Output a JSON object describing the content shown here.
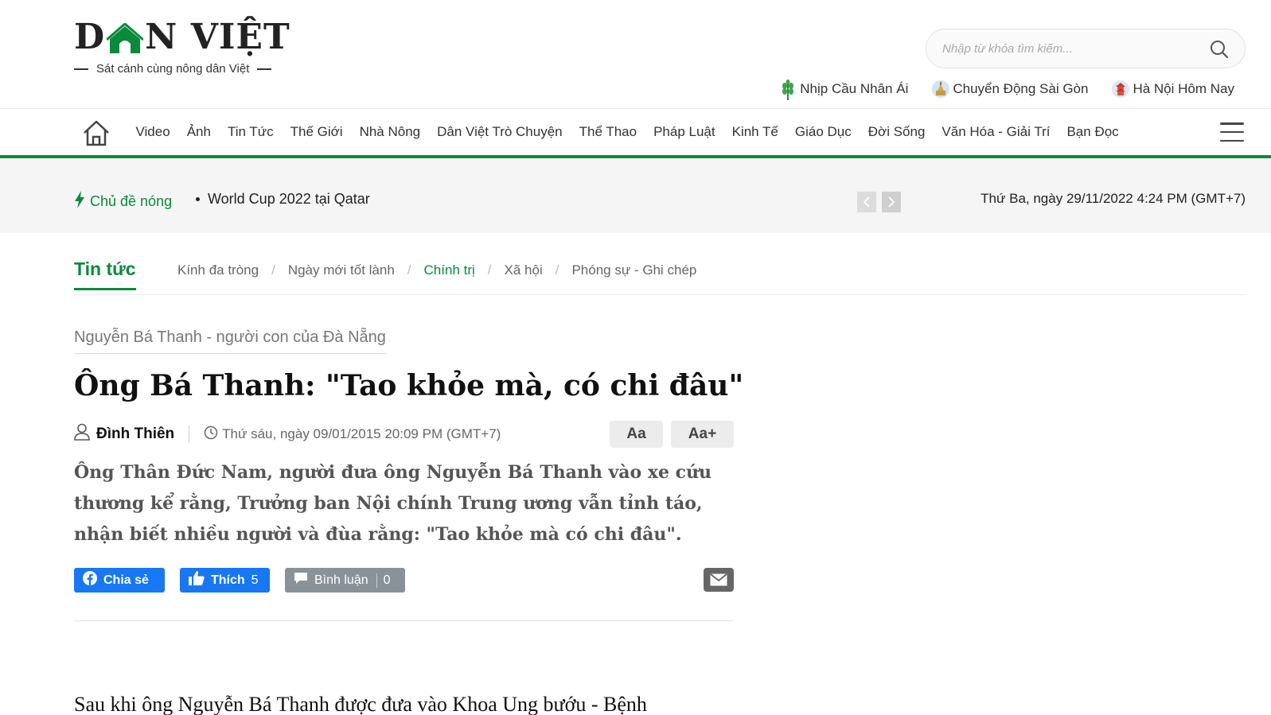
{
  "header": {
    "logo_text_before": "D",
    "logo_text_after": "N VIỆT",
    "logo_tagline": "Sát cánh cùng nông dân Việt",
    "search_placeholder": "Nhập từ khóa tìm kiếm...",
    "quick_links": [
      {
        "label": "Nhịp Cầu Nhân Ái",
        "icon": "wheat-icon"
      },
      {
        "label": "Chuyển Động Sài Gòn",
        "icon": "landmark-icon"
      },
      {
        "label": "Hà Nội Hôm Nay",
        "icon": "pagoda-icon"
      }
    ]
  },
  "nav": {
    "items": [
      "Video",
      "Ảnh",
      "Tin Tức",
      "Thế Giới",
      "Nhà Nông",
      "Dân Việt Trò Chuyện",
      "Thể Thao",
      "Pháp Luật",
      "Kinh Tế",
      "Giáo Dục",
      "Đời Sống",
      "Văn Hóa - Giải Trí",
      "Bạn Đọc"
    ]
  },
  "hotbar": {
    "label": "Chủ đề nóng",
    "topic": "World Cup 2022 tại Qatar",
    "date": "Thứ Ba, ngày 29/11/2022 4:24 PM (GMT+7)"
  },
  "category": {
    "main": "Tin tức",
    "subcategories": [
      "Kính đa tròng",
      "Ngày mới tốt lành",
      "Chính trị",
      "Xã hội",
      "Phóng sự - Ghi chép"
    ],
    "active_sub": "Chính trị"
  },
  "article": {
    "series": "Nguyễn Bá Thanh - người con của Đà Nẵng",
    "title": "Ông Bá Thanh: \"Tao khỏe mà, có chi đâu\"",
    "author": "Đình Thiên",
    "time": "Thứ sáu, ngày 09/01/2015 20:09 PM (GMT+7)",
    "font_small": "Aa",
    "font_large": "Aa+",
    "sapo": "Ông Thân Đức Nam, người đưa ông Nguyễn Bá Thanh vào xe cứu thương kể rằng, Trưởng ban Nội chính Trung ương vẫn tỉnh táo, nhận biết nhiều người và đùa rằng: \"Tao khỏe mà có chi đâu\".",
    "share_label": "Chia sẻ",
    "like_label": "Thích",
    "like_count": "5",
    "comment_label": "Bình luận",
    "comment_count": "0",
    "body_first_line": "Sau khi ông Nguyễn Bá Thanh được đưa vào Khoa Ung bướu - Bệnh"
  },
  "colors": {
    "brand_green": "#0a8a3a",
    "facebook_blue": "#1877f2"
  }
}
